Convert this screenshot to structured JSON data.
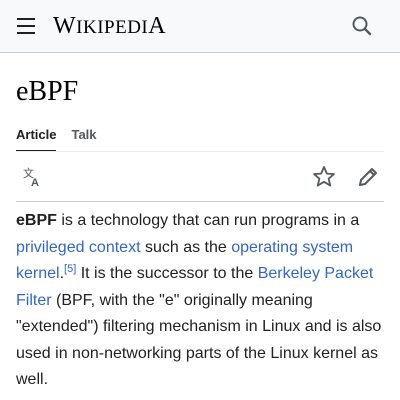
{
  "header": {
    "logo_first": "W",
    "logo_rest": "IKIPEDI",
    "logo_last": "A"
  },
  "page": {
    "title": "eBPF"
  },
  "tabs": [
    {
      "label": "Article",
      "active": true
    },
    {
      "label": "Talk",
      "active": false
    }
  ],
  "icons": {
    "menu": "hamburger-menu-icon",
    "search": "search-icon",
    "language": "language-icon",
    "watch": "star-icon",
    "edit": "pencil-icon"
  },
  "article": {
    "bold_term": "eBPF",
    "text1": " is a technology that can run programs in a ",
    "link1": "privileged context",
    "text2": " such as the ",
    "link2": "operating system kernel",
    "text3": ".",
    "ref": "[5]",
    "text4": " It is the successor to the ",
    "link3": "Berkeley Packet Filter",
    "text5": " (BPF, with the \"e\" originally meaning \"extended\") filtering mechanism in Linux and is also used in non-networking parts of the Linux kernel as well."
  },
  "colors": {
    "link": "#3366cc",
    "text": "#202122",
    "header_bg": "#f8f9fa"
  }
}
